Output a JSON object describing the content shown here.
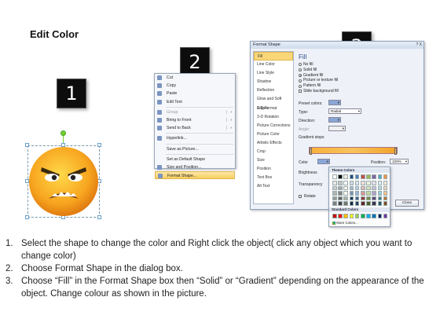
{
  "page": {
    "title": "Edit Color"
  },
  "badges": [
    "1",
    "2",
    "3"
  ],
  "context_menu": {
    "items": [
      {
        "label": "Cut",
        "disabled": false,
        "submenu": false,
        "icon": "scissors-icon"
      },
      {
        "label": "Copy",
        "disabled": false,
        "submenu": false,
        "icon": "copy-icon"
      },
      {
        "label": "Paste",
        "disabled": false,
        "submenu": false,
        "icon": "paste-icon"
      },
      {
        "label": "Edit Text",
        "disabled": false,
        "submenu": false,
        "icon": "edit-text-icon"
      },
      {
        "sep": true
      },
      {
        "label": "Group",
        "disabled": true,
        "submenu": true,
        "icon": "group-icon"
      },
      {
        "label": "Bring to Front",
        "disabled": false,
        "submenu": true,
        "icon": "bring-front-icon"
      },
      {
        "label": "Send to Back",
        "disabled": false,
        "submenu": true,
        "icon": "send-back-icon"
      },
      {
        "sep": true
      },
      {
        "label": "Hyperlink...",
        "disabled": false,
        "submenu": false,
        "icon": "hyperlink-icon"
      },
      {
        "sep": true
      },
      {
        "label": "Save as Picture...",
        "disabled": false,
        "submenu": false,
        "icon": ""
      },
      {
        "sep": true
      },
      {
        "label": "Set as Default Shape",
        "disabled": false,
        "submenu": false,
        "icon": ""
      },
      {
        "label": "Size and Position...",
        "disabled": false,
        "submenu": false,
        "icon": "size-position-icon"
      },
      {
        "label": "Format Shape...",
        "disabled": false,
        "submenu": false,
        "icon": "format-shape-icon",
        "highlighted": true
      }
    ]
  },
  "dialog": {
    "title": "Format Shape",
    "title_buttons": "? X",
    "nav": [
      "Fill",
      "Line Color",
      "Line Style",
      "Shadow",
      "Reflection",
      "Glow and Soft Edges",
      "3-D Format",
      "3-D Rotation",
      "Picture Corrections",
      "Picture Color",
      "Artistic Effects",
      "Crop",
      "Size",
      "Position",
      "Text Box",
      "Alt Text"
    ],
    "nav_selected": 0,
    "fill_heading": "Fill",
    "fill_options": [
      {
        "label": "No fill",
        "kind": "radio",
        "checked": false
      },
      {
        "label": "Solid fill",
        "kind": "radio",
        "checked": false
      },
      {
        "label": "Gradient fill",
        "kind": "radio",
        "checked": true
      },
      {
        "label": "Picture or texture fill",
        "kind": "radio",
        "checked": false
      },
      {
        "label": "Pattern fill",
        "kind": "radio",
        "checked": false
      },
      {
        "label": "Slide background fill",
        "kind": "checkbox",
        "checked": false
      }
    ],
    "preset_colors_label": "Preset colors:",
    "type_label": "Type:",
    "type_value": "Radial",
    "direction_label": "Direction:",
    "angle_label": "Angle:",
    "gradient_stops_label": "Gradient stops",
    "color_label": "Color",
    "position_label": "Position:",
    "position_value": "100%",
    "brightness_label": "Brightness",
    "transparency_label": "Transparency",
    "rotate_label": "Rotate",
    "close_label": "Close"
  },
  "palette": {
    "theme_label": "Theme Colors",
    "standard_label": "Standard Colors",
    "more_label": "More Colors...",
    "theme_top": [
      "#ffffff",
      "#000000",
      "#eeece1",
      "#1f497d",
      "#4f81bd",
      "#c0504d",
      "#9bbb59",
      "#8064a2",
      "#4bacc6",
      "#f79646"
    ],
    "standard": [
      "#c00000",
      "#ff0000",
      "#ffc000",
      "#ffff00",
      "#92d050",
      "#00b050",
      "#00b0f0",
      "#0070c0",
      "#002060",
      "#7030a0"
    ]
  },
  "steps": [
    {
      "num": "1.",
      "text": "Select the shape to change the color and Right click the object( click any object which you want to change color)"
    },
    {
      "num": "2.",
      "text": "Choose Format Shape in the dialog box."
    },
    {
      "num": "3.",
      "text": "Choose “Fill” in the Format Shape box then “Solid” or “Gradient” depending on the appearance of the object. Change colour as shown in the picture."
    }
  ]
}
